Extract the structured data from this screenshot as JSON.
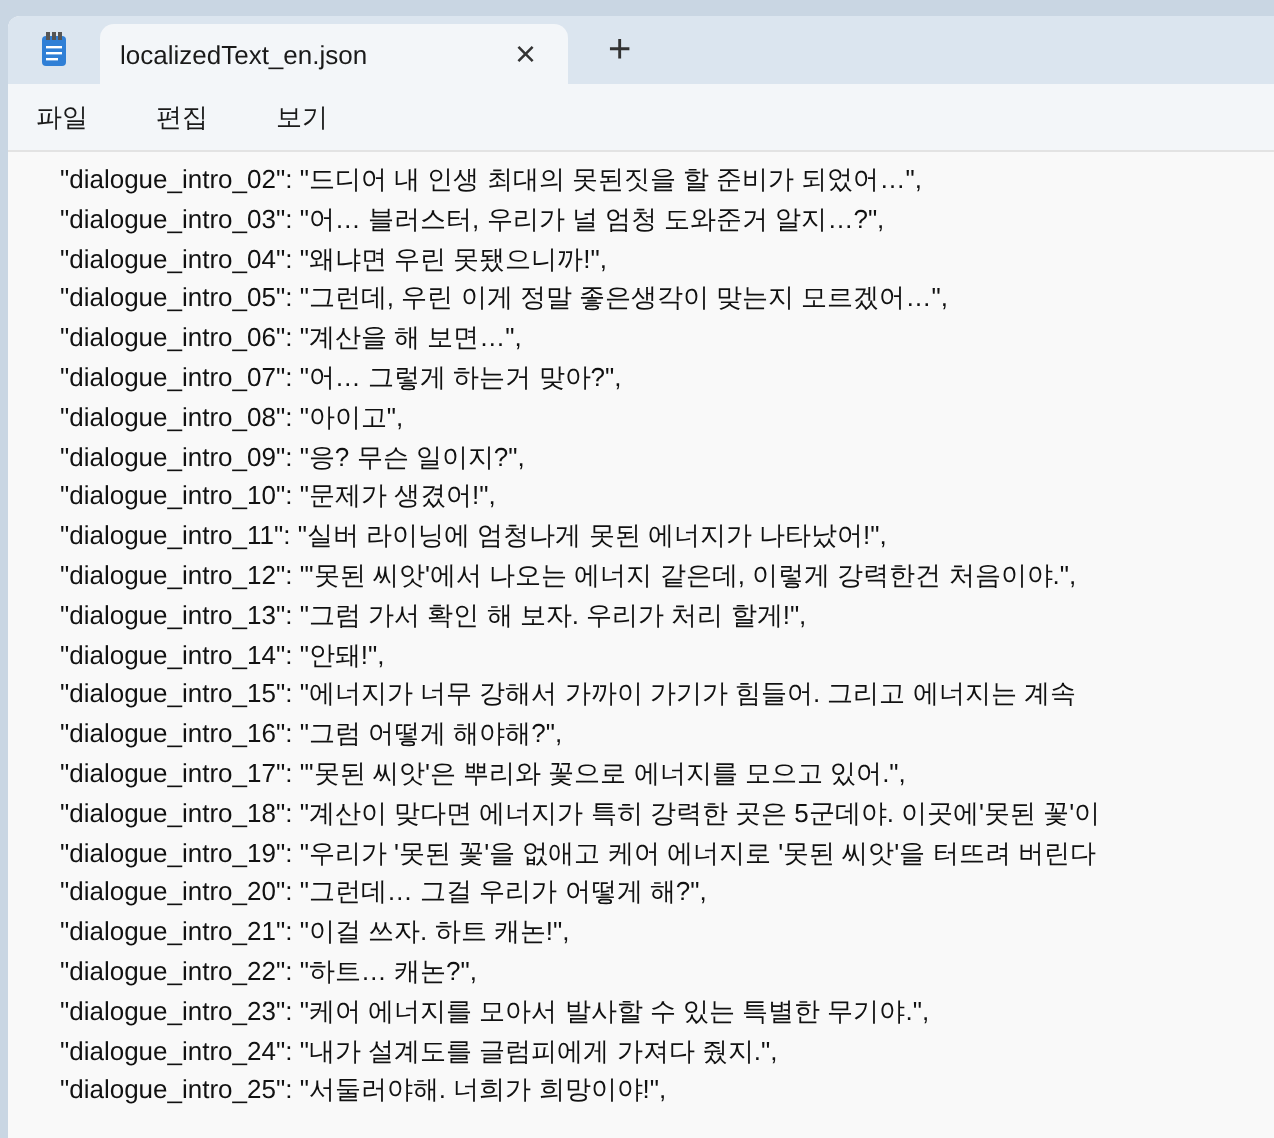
{
  "tab": {
    "title": "localizedText_en.json",
    "close": "×",
    "new_tab": "+"
  },
  "menu": [
    "파일",
    "편집",
    "보기"
  ],
  "lines": [
    "\"dialogue_intro_02\": \"드디어 내 인생 최대의 못된짓을 할 준비가 되었어…\",",
    "\"dialogue_intro_03\": \"어… 블러스터, 우리가 널 엄청 도와준거 알지…?\",",
    "\"dialogue_intro_04\": \"왜냐면 우린 못됐으니까!\",",
    "\"dialogue_intro_05\": \"그런데, 우린 이게 정말 좋은생각이 맞는지 모르겠어…\",",
    "\"dialogue_intro_06\": \"계산을 해 보면…\",",
    "\"dialogue_intro_07\": \"어… 그렇게 하는거 맞아?\",",
    "\"dialogue_intro_08\": \"아이고\",",
    "\"dialogue_intro_09\": \"응? 무슨 일이지?\",",
    "\"dialogue_intro_10\": \"문제가 생겼어!\",",
    "\"dialogue_intro_11\": \"실버 라이닝에 엄청나게 못된 에너지가 나타났어!\",",
    "\"dialogue_intro_12\": \"'못된 씨앗'에서 나오는 에너지 같은데, 이렇게 강력한건 처음이야.\",",
    "\"dialogue_intro_13\": \"그럼 가서 확인 해 보자. 우리가 처리 할게!\",",
    "\"dialogue_intro_14\": \"안돼!\",",
    "\"dialogue_intro_15\": \"에너지가 너무 강해서 가까이 가기가 힘들어. 그리고 에너지는 계속",
    "\"dialogue_intro_16\": \"그럼 어떻게 해야해?\",",
    "\"dialogue_intro_17\": \"'못된 씨앗'은 뿌리와 꽃으로 에너지를 모으고 있어.\",",
    "\"dialogue_intro_18\": \"계산이 맞다면 에너지가 특히 강력한 곳은 5군데야. 이곳에'못된 꽃'이",
    "\"dialogue_intro_19\": \"우리가 '못된 꽃'을 없애고 케어 에너지로 '못된 씨앗'을 터뜨려 버린다",
    "\"dialogue_intro_20\": \"그런데… 그걸 우리가 어떻게 해?\",",
    "\"dialogue_intro_21\": \"이걸 쓰자. 하트 캐논!\",",
    "\"dialogue_intro_22\": \"하트… 캐논?\",",
    "\"dialogue_intro_23\": \"케어 에너지를 모아서 발사할 수 있는 특별한 무기야.\",",
    "\"dialogue_intro_24\": \"내가 설계도를 글럼피에게 가져다 줬지.\",",
    "\"dialogue_intro_25\": \"서둘러야해. 너희가 희망이야!\","
  ]
}
